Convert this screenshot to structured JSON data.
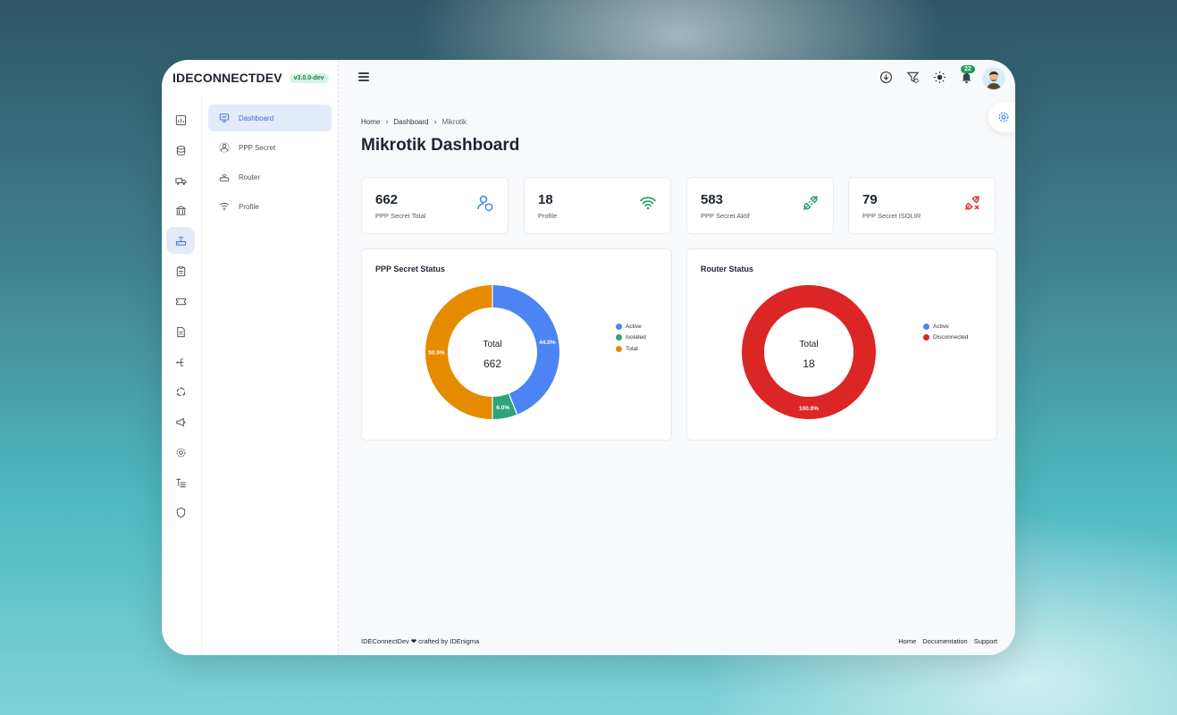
{
  "brand": {
    "name": "IDECONNECTDEV",
    "version": "v3.0.0-dev"
  },
  "rail": {
    "icons": [
      "chart-icon",
      "database-icon",
      "truck-icon",
      "bank-icon",
      "router-icon",
      "clipboard-icon",
      "ticket-icon",
      "document-icon",
      "tree-icon",
      "cycle-icon",
      "megaphone-icon",
      "gear-icon",
      "text-icon",
      "shield-icon"
    ],
    "active_index": 4
  },
  "menu": {
    "items": [
      {
        "label": "Dashboard",
        "icon": "presentation-icon",
        "active": true
      },
      {
        "label": "PPP Secret",
        "icon": "users-gear-icon",
        "active": false
      },
      {
        "label": "Router",
        "icon": "router-icon",
        "active": false
      },
      {
        "label": "Profile",
        "icon": "wifi-icon",
        "active": false
      }
    ]
  },
  "topbar": {
    "notification_count": "22"
  },
  "breadcrumb": {
    "home": "Home",
    "dashboard": "Dashboard",
    "current": "Mikrotik"
  },
  "page": {
    "title": "Mikrotik Dashboard"
  },
  "stats": [
    {
      "value": "662",
      "label": "PPP Secret Total",
      "icon": "user-shield-icon",
      "color": "#3b82f6"
    },
    {
      "value": "18",
      "label": "Profile",
      "icon": "wifi-icon",
      "color": "#22a06b"
    },
    {
      "value": "583",
      "label": "PPP Secret Aktif",
      "icon": "plug-connected-icon",
      "color": "#22a06b"
    },
    {
      "value": "79",
      "label": "PPP Secret ISOLIR",
      "icon": "plug-disconnected-icon",
      "color": "#e03131"
    }
  ],
  "chart_data": [
    {
      "type": "pie",
      "title": "PPP Secret Status",
      "center_label": "Total",
      "center_value": "662",
      "slices": [
        {
          "name": "Active",
          "percent": 44.0,
          "label": "44.0%",
          "color": "#4c84f4"
        },
        {
          "name": "Isolated",
          "percent": 6.0,
          "label": "6.0%",
          "color": "#2ca57a"
        },
        {
          "name": "Total",
          "percent": 50.0,
          "label": "50.0%",
          "color": "#e68a00"
        }
      ],
      "legend": [
        "Active",
        "Isolated",
        "Total"
      ],
      "legend_position": "right"
    },
    {
      "type": "pie",
      "title": "Router Status",
      "center_label": "Total",
      "center_value": "18",
      "slices": [
        {
          "name": "Active",
          "percent": 0.0,
          "label": "",
          "color": "#4c84f4"
        },
        {
          "name": "Disconnected",
          "percent": 100.0,
          "label": "100.0%",
          "color": "#dc2626"
        }
      ],
      "legend": [
        "Active",
        "Disconnected"
      ],
      "legend_position": "right"
    }
  ],
  "footer": {
    "left": "IDEConnectDev ❤ crafted by IDEnigma",
    "links": [
      "Home",
      "Documentation",
      "Support"
    ]
  }
}
